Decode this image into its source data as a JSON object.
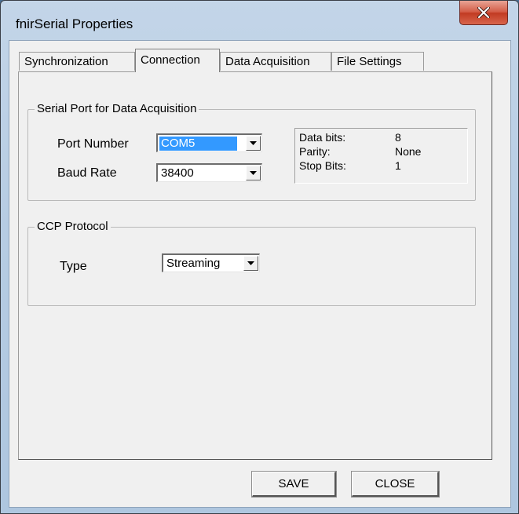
{
  "window": {
    "title": "fnirSerial Properties"
  },
  "tabs": [
    {
      "label": "Synchronization"
    },
    {
      "label": "Connection"
    },
    {
      "label": "Data Acquisition"
    },
    {
      "label": "File Settings"
    }
  ],
  "serial_group": {
    "title": "Serial Port for Data Acquisition",
    "port_label": "Port Number",
    "port_value": "COM5",
    "baud_label": "Baud Rate",
    "baud_value": "38400",
    "info": {
      "data_bits_label": "Data bits:",
      "data_bits_value": "8",
      "parity_label": "Parity:",
      "parity_value": "None",
      "stop_bits_label": "Stop Bits:",
      "stop_bits_value": "1"
    }
  },
  "ccp_group": {
    "title": "CCP Protocol",
    "type_label": "Type",
    "type_value": "Streaming"
  },
  "buttons": {
    "save": "SAVE",
    "close": "CLOSE"
  }
}
